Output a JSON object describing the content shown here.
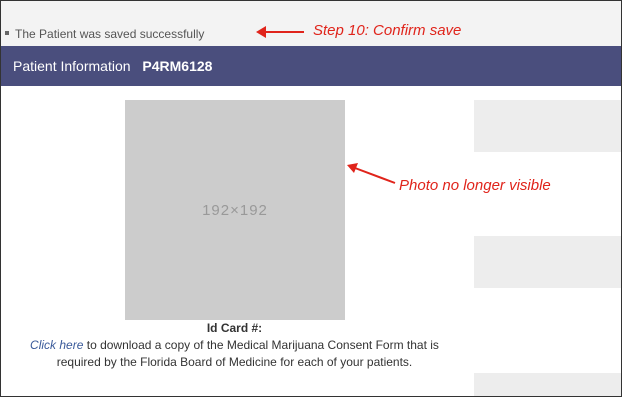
{
  "status": {
    "message": "The Patient was saved successfully"
  },
  "header": {
    "title": "Patient Information",
    "patient_id": "P4RM6128"
  },
  "photo": {
    "placeholder_text": "192×192"
  },
  "id_card": {
    "label": "Id Card #:"
  },
  "consent": {
    "link_text": "Click here",
    "text": " to download a copy of the Medical Marijuana Consent Form that is required by the Florida Board of Medicine for each of your patients."
  },
  "annotations": {
    "confirm_save": "Step 10: Confirm save",
    "photo_hidden": "Photo no longer visible"
  },
  "colors": {
    "header_bg": "#4a4e7d",
    "photo_bg": "#cccccc",
    "annotation": "#e0241b",
    "link": "#3a5a9a"
  }
}
